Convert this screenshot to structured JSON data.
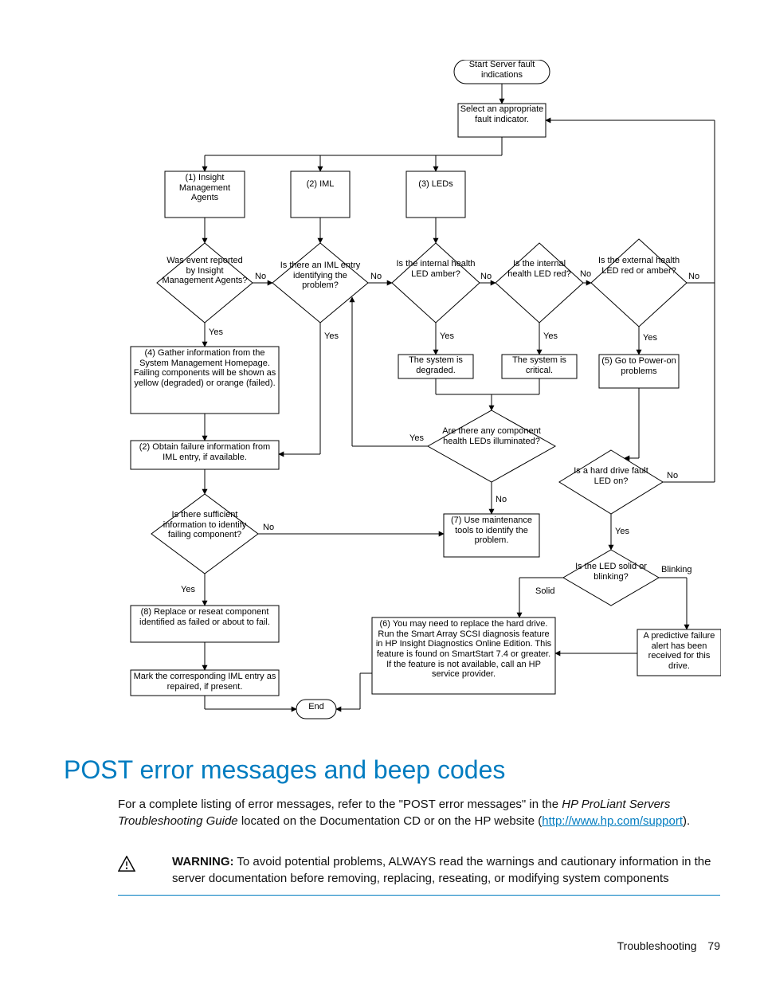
{
  "heading": "POST error messages and beep codes",
  "paragraph": {
    "p1a": "For a complete listing of error messages, refer to the \"POST error messages\" in the ",
    "p1b_italic": "HP ProLiant Servers Troubleshooting Guide",
    "p1c": " located on the Documentation CD or on the HP website (",
    "link": "http://www.hp.com/support",
    "p1d": ")."
  },
  "warning": {
    "label": "WARNING:",
    "text": "  To avoid potential problems, ALWAYS read the warnings and cautionary information in the server documentation before removing, replacing, reseating, or modifying system components"
  },
  "footer": {
    "section": "Troubleshooting",
    "page": "79"
  },
  "flowchart": {
    "nodes": {
      "start": "Start Server fault indications",
      "select": "Select an appropriate fault indicator.",
      "b1": "(1)\nInsight Management Agents",
      "b2": "(2)\nIML",
      "b3": "(3)\nLEDs",
      "d_event": "Was event reported by Insight Management Agents?",
      "d_iml": "Is there an IML entry identifying the problem?",
      "d_intAmber": "Is the internal health LED amber?",
      "d_intRed": "Is the internal health LED red?",
      "d_extRed": "Is the external health LED red or amber?",
      "sys_deg": "The system is degraded.",
      "sys_crit": "The system is critical.",
      "b5": "(5)\nGo to Power-on problems",
      "b4": "(4)\nGather information from the System Management Homepage. Failing components will be shown as yellow (degraded) or orange (failed).",
      "d_comp": "Are there any component health LEDs illuminated?",
      "b2b": "(2)\nObtain failure information from IML entry, if available.",
      "d_hd": "Is a hard drive fault LED on?",
      "d_suff": "Is there sufficient information to identify failing component?",
      "b7": "(7)\nUse maintenance tools to identify the problem.",
      "d_blink": "Is the LED solid or blinking?",
      "b8": "(8)\nReplace or reseat component identified as failed or about to fail.",
      "b6": "(6)\nYou may need to replace the hard drive. Run the Smart Array SCSI diagnosis feature in HP Insight Diagnostics Online Edition. This feature is found on SmartStart 7.4 or greater. If the feature is not available, call an HP service provider.",
      "pred": "A predictive failure alert has been received for this drive.",
      "mark": "Mark the corresponding IML entry as repaired, if present.",
      "end": "End"
    },
    "labels": {
      "yes": "Yes",
      "no": "No",
      "solid": "Solid",
      "blinking": "Blinking"
    }
  }
}
